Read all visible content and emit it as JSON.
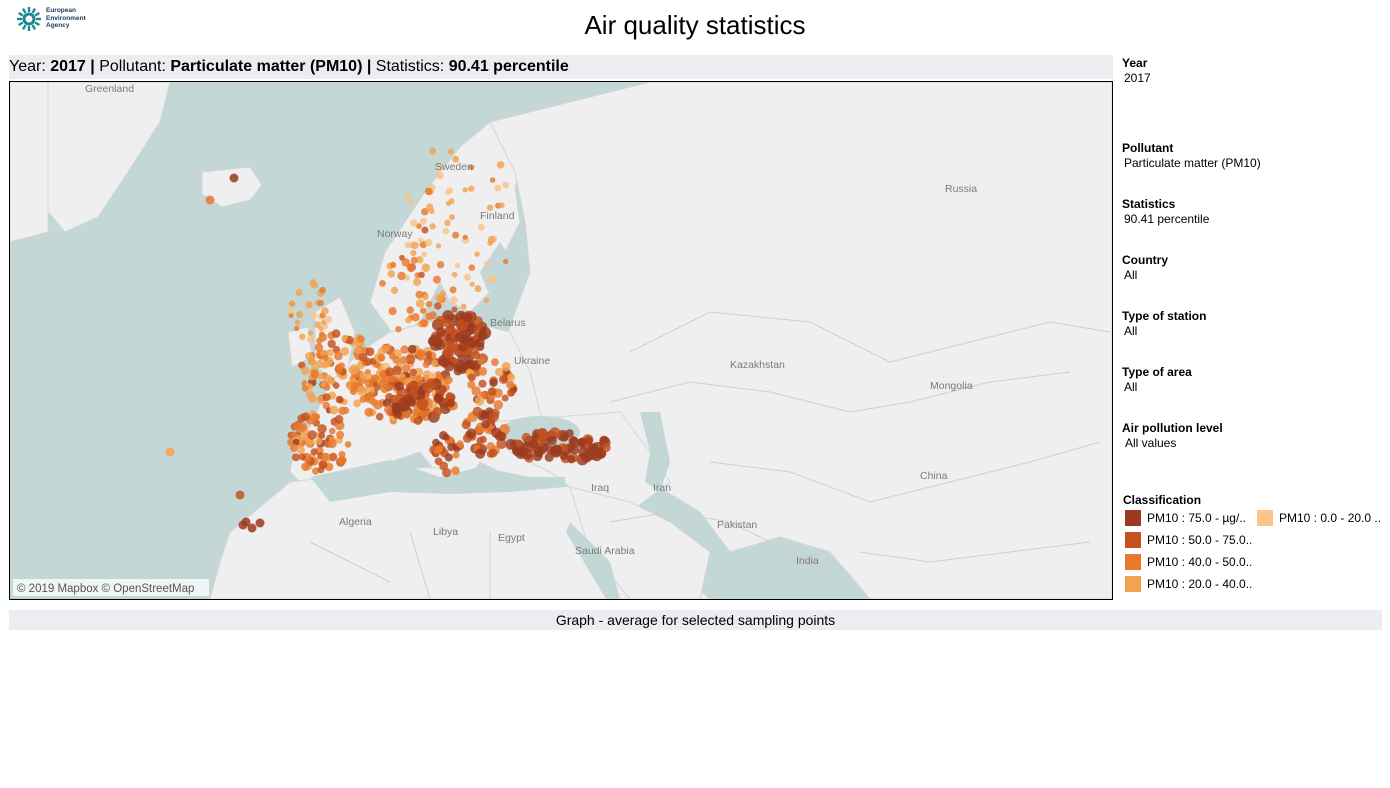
{
  "header": {
    "logo_lines": [
      "European",
      "Environment",
      "Agency"
    ],
    "title": "Air quality statistics"
  },
  "subtitle": {
    "year_label": "Year: ",
    "year_value": "2017",
    "sep1": " | ",
    "pollutant_label": "Pollutant: ",
    "pollutant_value": "Particulate matter (PM10)",
    "sep2": " | ",
    "stat_label": "Statistics: ",
    "stat_value": "90.41 percentile"
  },
  "filters": [
    {
      "label": "Year",
      "value": "2017"
    },
    {
      "label": "Pollutant",
      "value": "Particulate matter (PM10)"
    },
    {
      "label": "Statistics",
      "value": "90.41 percentile"
    },
    {
      "label": "Country",
      "value": "All"
    },
    {
      "label": "Type of station",
      "value": "All"
    },
    {
      "label": "Type of area",
      "value": "All"
    },
    {
      "label": "Air pollution level",
      "value": "All values"
    }
  ],
  "legend": {
    "title": "Classification",
    "items": [
      {
        "label": "PM10 : 75.0 -  µg/..",
        "color": "#9b3a1e"
      },
      {
        "label": "PM10 : 50.0 - 75.0..",
        "color": "#c4511f"
      },
      {
        "label": "PM10 : 40.0 - 50.0..",
        "color": "#e8792d"
      },
      {
        "label": "PM10 : 20.0 - 40.0..",
        "color": "#f3a250"
      },
      {
        "label": "PM10 : 0.0 - 20.0 ..",
        "color": "#f9c58a"
      }
    ]
  },
  "map": {
    "attribution": "© 2019 Mapbox © OpenStreetMap",
    "labels": [
      "Greenland",
      "Sweden",
      "Finland",
      "Norway",
      "Russia",
      "Belarus",
      "Ukraine",
      "Kazakhstan",
      "Mongolia",
      "China",
      "Iraq",
      "Iran",
      "Algeria",
      "Libya",
      "Egypt",
      "Saudi Arabia",
      "Pakistan",
      "India"
    ]
  },
  "graph_bar": {
    "label": "Graph - average for selected sampling points"
  }
}
